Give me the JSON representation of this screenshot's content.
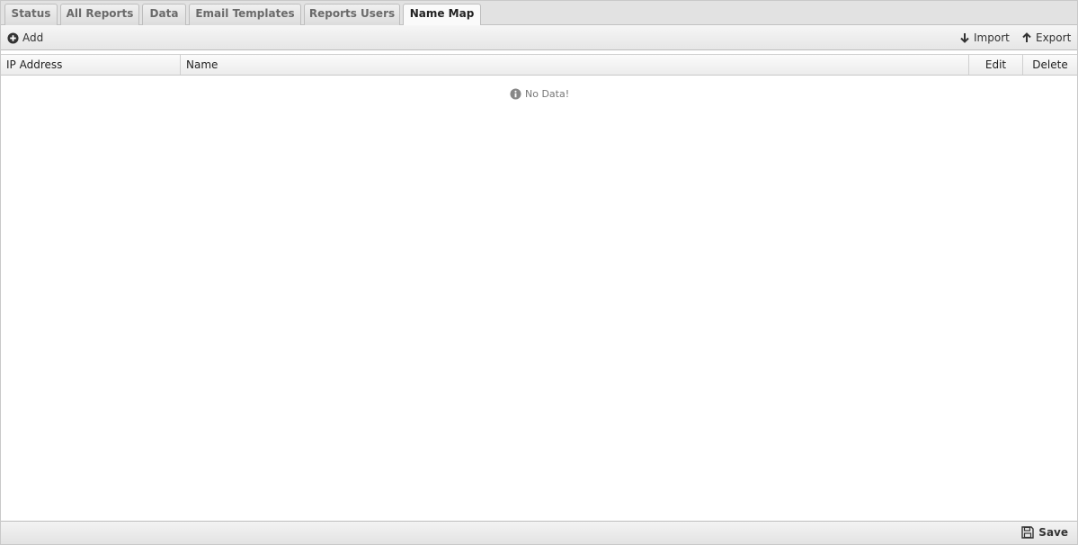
{
  "tabs": [
    {
      "label": "Status",
      "active": false
    },
    {
      "label": "All Reports",
      "active": false
    },
    {
      "label": "Data",
      "active": false
    },
    {
      "label": "Email Templates",
      "active": false
    },
    {
      "label": "Reports Users",
      "active": false
    },
    {
      "label": "Name Map",
      "active": true
    }
  ],
  "toolbar": {
    "add_label": "Add",
    "import_label": "Import",
    "export_label": "Export",
    "icons": {
      "add": "plus-circle-icon",
      "import": "arrow-down-icon",
      "export": "arrow-up-icon"
    }
  },
  "grid": {
    "columns": [
      "IP Address",
      "Name",
      "Edit",
      "Delete"
    ],
    "rows": [],
    "empty_message": "No Data!",
    "empty_icon": "info-icon"
  },
  "footer": {
    "save_label": "Save",
    "save_icon": "floppy-disk-icon"
  }
}
